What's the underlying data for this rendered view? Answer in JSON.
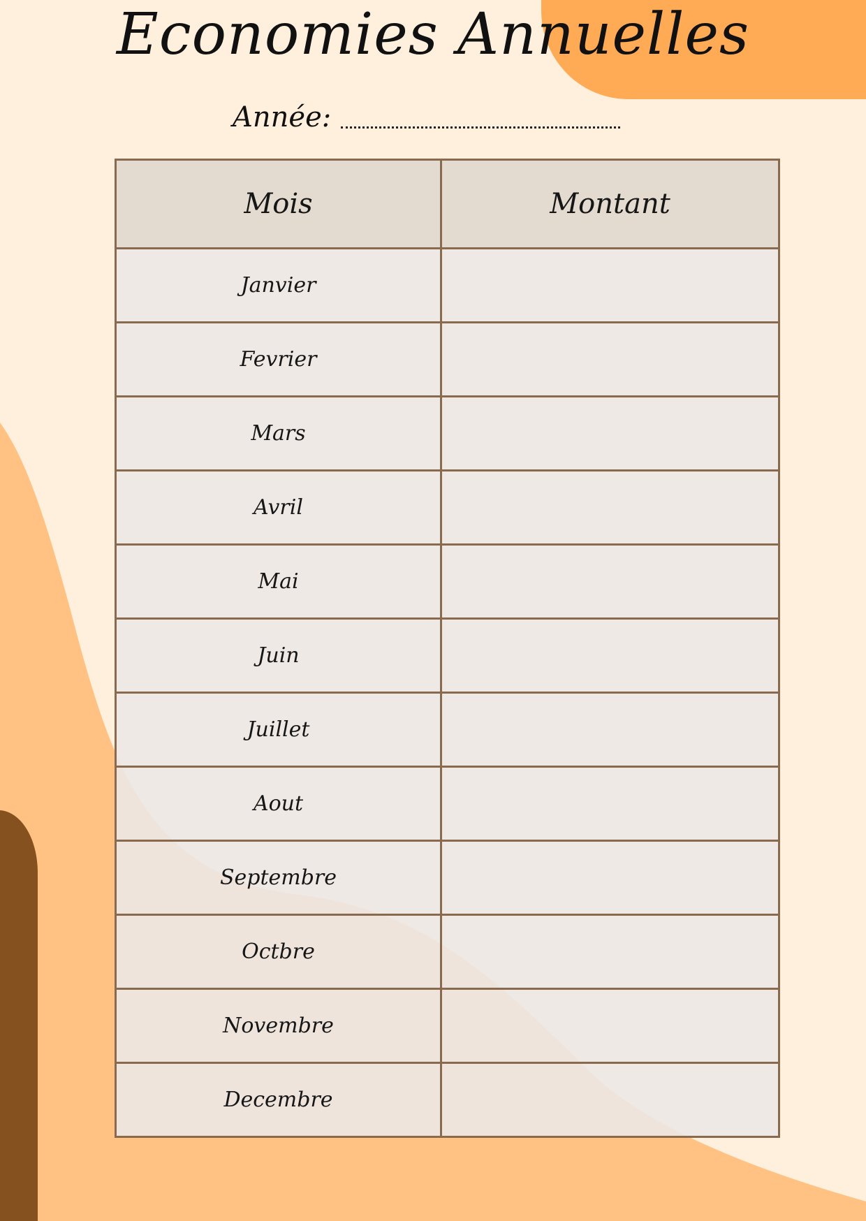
{
  "document": {
    "title": "Economies Annuelles",
    "year_label": "Année:"
  },
  "table": {
    "headers": {
      "month": "Mois",
      "amount": "Montant"
    },
    "rows": [
      {
        "month": "Janvier",
        "amount": ""
      },
      {
        "month": "Fevrier",
        "amount": ""
      },
      {
        "month": "Mars",
        "amount": ""
      },
      {
        "month": "Avril",
        "amount": ""
      },
      {
        "month": "Mai",
        "amount": ""
      },
      {
        "month": "Juin",
        "amount": ""
      },
      {
        "month": "Juillet",
        "amount": ""
      },
      {
        "month": "Aout",
        "amount": ""
      },
      {
        "month": "Septembre",
        "amount": ""
      },
      {
        "month": "Octbre",
        "amount": ""
      },
      {
        "month": "Novembre",
        "amount": ""
      },
      {
        "month": "Decembre",
        "amount": ""
      }
    ]
  },
  "colors": {
    "background": "#fef0dc",
    "accent_orange": "#ffab55",
    "light_orange": "#ffc283",
    "brown": "#85521f",
    "table_border": "#8a6a4e",
    "header_fill": "#e4dacd",
    "cell_fill": "#ede8e6"
  }
}
